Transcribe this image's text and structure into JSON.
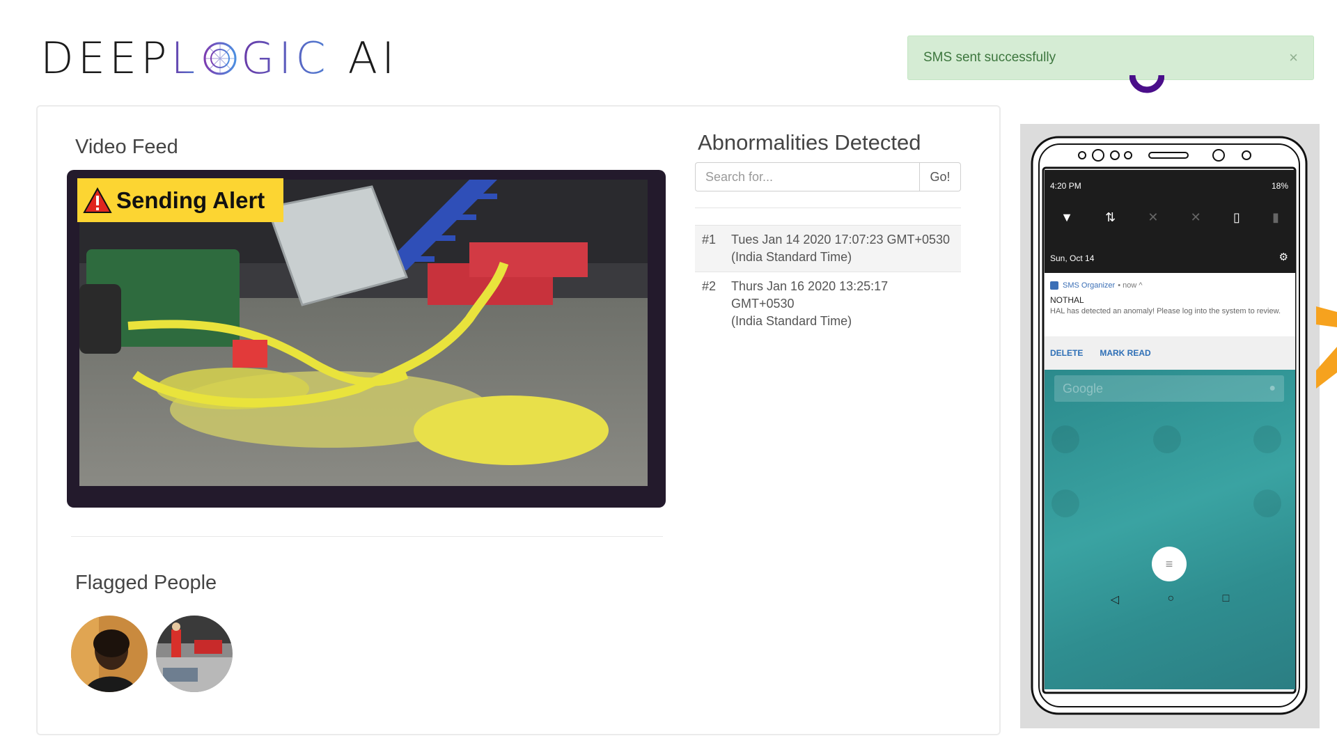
{
  "logo": {
    "left": "DEEP",
    "l": "L",
    "gic": "GIC",
    "ai": "AI"
  },
  "toast": {
    "message": "SMS sent successfully",
    "close": "×"
  },
  "video": {
    "title": "Video Feed",
    "alert": "Sending Alert"
  },
  "abnormalities": {
    "title": "Abnormalities Detected",
    "search_placeholder": "Search for...",
    "go_label": "Go!",
    "items": [
      {
        "num": "#1",
        "line1": "Tues Jan 14 2020 17:07:23 GMT+0530",
        "line2": "(India Standard Time)"
      },
      {
        "num": "#2",
        "line1": "Thurs Jan 16 2020 13:25:17 GMT+0530",
        "line2": "(India Standard Time)"
      }
    ]
  },
  "flagged": {
    "title": "Flagged People"
  },
  "phone": {
    "time": "4:20 PM",
    "battery": "18%",
    "date": "Sun, Oct 14",
    "app_name": "SMS Organizer",
    "app_meta": "• now ^",
    "notif_title": "NOTHAL",
    "notif_body": "HAL has detected an anomaly! Please log into the system to review.",
    "action_delete": "DELETE",
    "action_read": "MARK READ",
    "google": "Google"
  },
  "colors": {
    "accent": "#6a3aa8",
    "toast_bg": "#d5ecd4",
    "alert": "#fcd532"
  }
}
